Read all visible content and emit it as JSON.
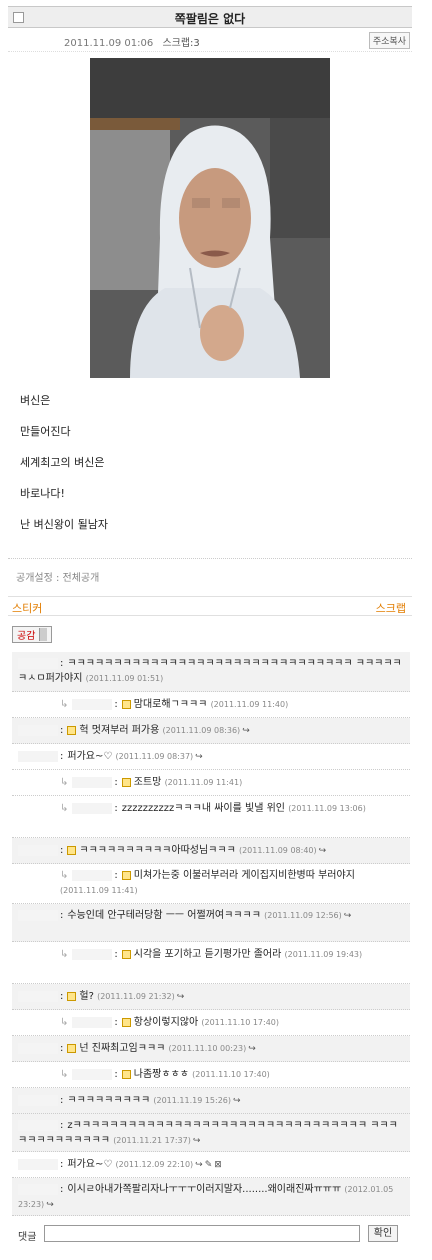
{
  "post": {
    "title": "쪽팔림은 없다",
    "date": "2011.11.09 01:06",
    "scrap_count": "스크랩:3",
    "copy_address": "주소복사",
    "body_lines": [
      "벼신은",
      "만들어진다",
      "세계최고의 벼신은",
      "바로나다!",
      "난 벼신왕이 될남자"
    ],
    "visibility": "공개설정 : 전체공개"
  },
  "actions": {
    "sticker": "스티커",
    "scrap": "스크랩",
    "gongam": "공감"
  },
  "comments": [
    {
      "reply": false,
      "text": "ㅋㅋㅋㅋㅋㅋㅋㅋㅋㅋㅋㅋㅋㅋㅋㅋㅋㅋㅋㅋㅋㅋㅋㅋㅋㅋㅋㅋㅋㅋㅋ ㅋㅋㅋㅋㅋㅋㅅㅁ퍼가야지",
      "ts": "(2011.11.09 01:51)"
    },
    {
      "reply": true,
      "text": "맘대로해ㄱㅋㅋㅋ",
      "ts": "(2011.11.09 11:40)"
    },
    {
      "reply": false,
      "text": "헉 멋져부러 퍼가용",
      "ts": "(2011.11.09 08:36)"
    },
    {
      "reply": false,
      "text": "퍼가요~♡",
      "ts": "(2011.11.09 08:37)"
    },
    {
      "reply": true,
      "text": "조트망",
      "ts": "(2011.11.09 11:41)"
    },
    {
      "reply": true,
      "text": "zzzzzzzzzzㅋㅋㅋ내 싸이를 빛낼 위인",
      "ts": "(2011.11.09 13:06)"
    },
    {
      "reply": false,
      "text": "ㅋㅋㅋㅋㅋㅋㅋㅋㅋㅋ아따성님ㅋㅋㅋ",
      "ts": "(2011.11.09 08:40)"
    },
    {
      "reply": true,
      "text": "미쳐가는중 이불러부러라 게이집지비한병따 부러야지",
      "ts": "(2011.11.09 11:41)"
    },
    {
      "reply": false,
      "text": "수능인데 안구테러당함 ㅡㅡ 어쩔꺼여ㅋㅋㅋㅋ",
      "ts": "(2011.11.09 12:56)"
    },
    {
      "reply": true,
      "text": "시각을 포기하고 듣기평가만 졸어라",
      "ts": "(2011.11.09 19:43)"
    },
    {
      "reply": false,
      "text": "헐?",
      "ts": "(2011.11.09 21:32)"
    },
    {
      "reply": true,
      "text": "항상이렇지않아",
      "ts": "(2011.11.10 17:40)"
    },
    {
      "reply": false,
      "text": "넌 진짜최고임ㅋㅋㅋ",
      "ts": "(2011.11.10 00:23)"
    },
    {
      "reply": true,
      "text": "나좀짱ㅎㅎㅎ",
      "ts": "(2011.11.10 17:40)"
    },
    {
      "reply": false,
      "text": "ㅋㅋㅋㅋㅋㅋㅋㅋㅋ",
      "ts": "(2011.11.19 15:26)"
    },
    {
      "reply": false,
      "text": "zㅋㅋㅋㅋㅋㅋㅋㅋㅋㅋㅋㅋㅋㅋㅋㅋㅋㅋㅋㅋㅋㅋㅋㅋㅋㅋㅋㅋㅋㅋㅋㅋ ㅋㅋㅋㅋㅋㅋㅋㅋㅋㅋㅋㅋㅋ",
      "ts": "(2011.11.21 17:37)"
    },
    {
      "reply": false,
      "text": "퍼가요~♡",
      "ts": "(2011.12.09 22:10)"
    },
    {
      "reply": false,
      "text": "이시ㄹ아내가쪽팔리자나ㅜㅜㅜ이러지말자........왜이래진짜ㅠㅠㅠ",
      "ts": "(2012.01.05 23:23)"
    }
  ],
  "reply_box": {
    "label": "댓글",
    "submit": "확인"
  }
}
